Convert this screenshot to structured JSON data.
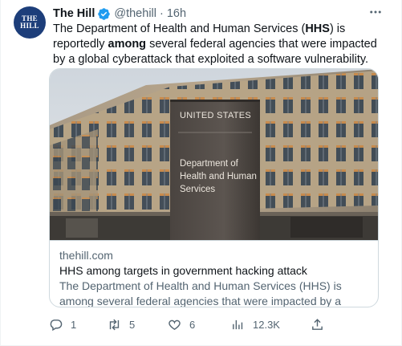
{
  "author": {
    "name": "The Hill",
    "handle": "@thehill",
    "separator": "·",
    "time": "16h",
    "avatar_text_line1": "THE",
    "avatar_text_line2": "HILL"
  },
  "tweet": {
    "text_part1": "The Department of Health and Human Services (",
    "text_bold1": "HHS",
    "text_part2": ") is reportedly ",
    "text_bold2": "among",
    "text_part3": " several federal agencies that were impacted by a global cyberattack that exploited a software vulnerability."
  },
  "card": {
    "sign_line1": "UNITED STATES",
    "sign_line2": "Department of",
    "sign_line3": "Health and Human",
    "sign_line4": "Services",
    "domain": "thehill.com",
    "title": "HHS among targets in government hacking attack",
    "description": "The Department of Health and Human Services (HHS) is among several federal agencies that were impacted by a global cyberattack ..."
  },
  "actions": {
    "reply_count": "1",
    "retweet_count": "5",
    "like_count": "6",
    "view_count": "12.3K"
  },
  "colors": {
    "text_primary": "#0f1419",
    "text_secondary": "#536471",
    "verified": "#1d9bf0",
    "avatar_bg": "#1d3e7a",
    "border": "#cfd9de"
  },
  "icons": {
    "more": "more-horizontal-icon",
    "verified": "verified-badge-icon",
    "reply": "reply-icon",
    "retweet": "retweet-icon",
    "like": "heart-icon",
    "views": "views-chart-icon",
    "share": "share-icon"
  }
}
